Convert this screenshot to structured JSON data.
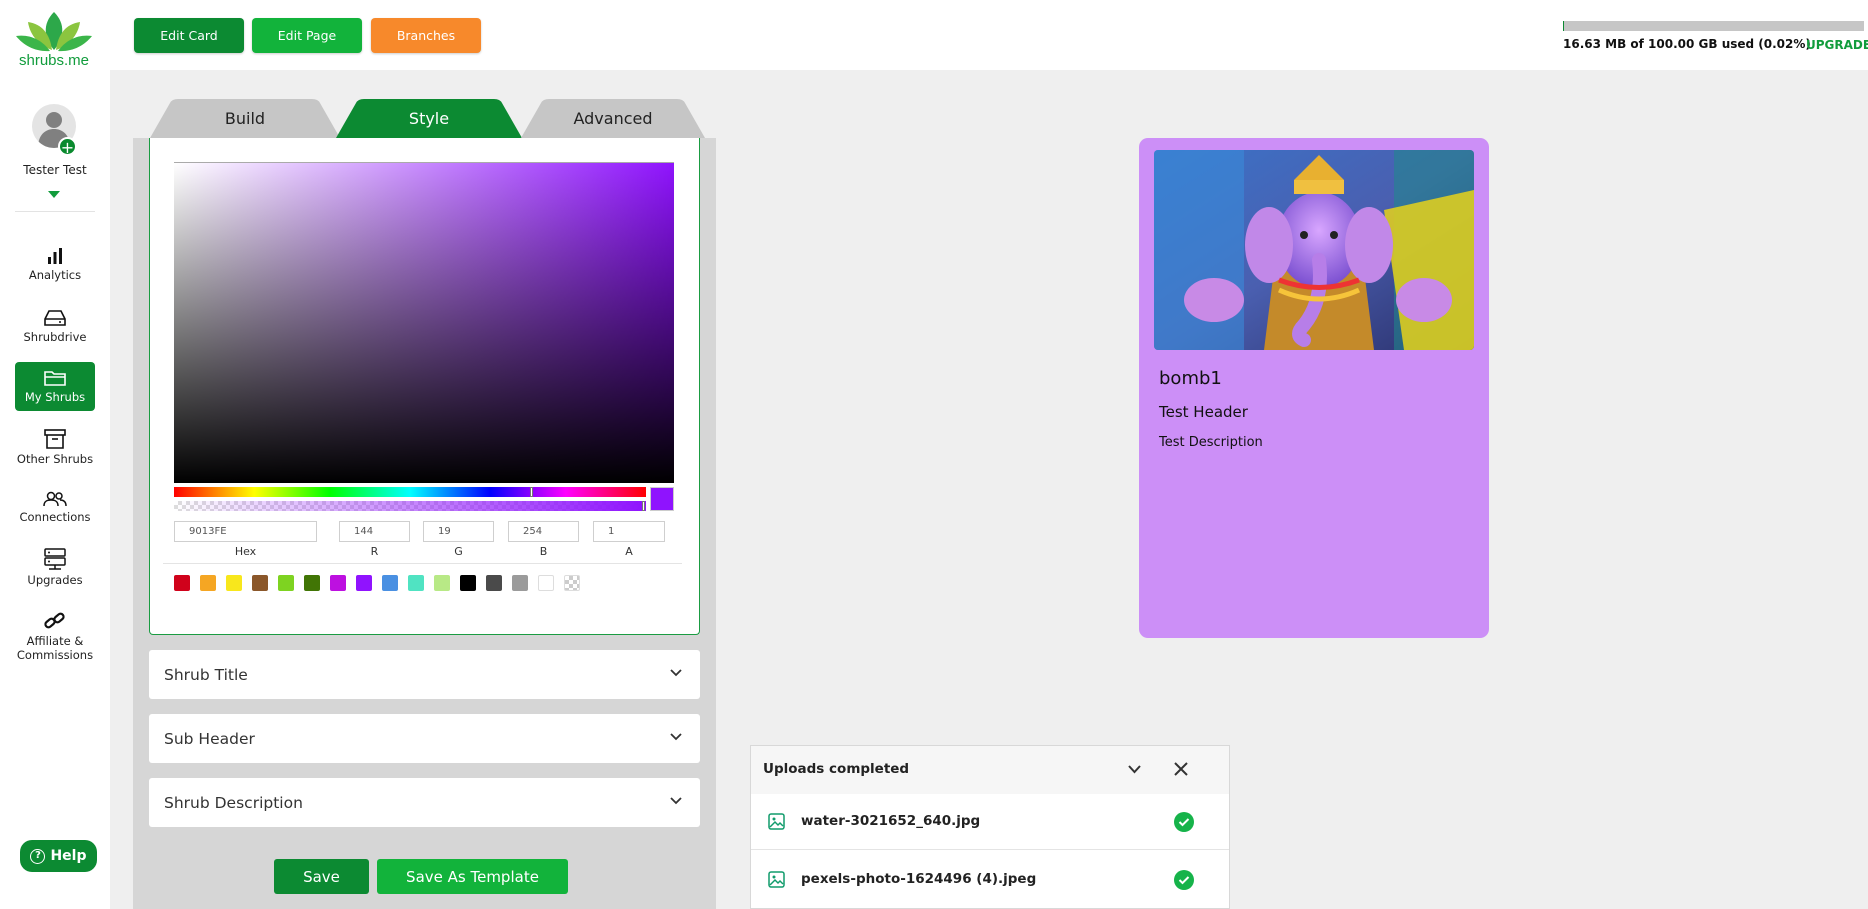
{
  "brand": {
    "name": "shrubs.me",
    "color": "#119c3c"
  },
  "user": {
    "name": "Tester Test"
  },
  "sidebar": {
    "items": [
      {
        "label": "Analytics",
        "icon": "bar-chart-icon"
      },
      {
        "label": "Shrubdrive",
        "icon": "hard-drive-icon"
      },
      {
        "label": "My Shrubs",
        "icon": "folder-icon",
        "active": true
      },
      {
        "label": "Other Shrubs",
        "icon": "archive-icon"
      },
      {
        "label": "Connections",
        "icon": "users-icon"
      },
      {
        "label": "Upgrades",
        "icon": "server-icon"
      },
      {
        "label": "Affiliate &",
        "label2": "Commissions",
        "icon": "link-icon"
      }
    ],
    "help_label": "Help"
  },
  "topbar": {
    "buttons": [
      {
        "label": "Edit Card",
        "color": "#0c8a32"
      },
      {
        "label": "Edit Page",
        "color": "#12b33b"
      },
      {
        "label": "Branches",
        "color": "#f7892b"
      }
    ],
    "storage": {
      "text": "16.63 MB of 100.00 GB used (0.02%)",
      "percent": 0.02
    },
    "upgrade_label": "UPGRADE"
  },
  "tabs": [
    {
      "label": "Build",
      "active": false
    },
    {
      "label": "Style",
      "active": true
    },
    {
      "label": "Advanced",
      "active": false
    }
  ],
  "color_picker": {
    "current_color": "#8f13fe",
    "hex": "9013FE",
    "r": "144",
    "g": "19",
    "b": "254",
    "a": "1",
    "labels": {
      "hex": "Hex",
      "r": "R",
      "g": "G",
      "b": "B",
      "a": "A"
    },
    "presets": [
      "#d0021b",
      "#f5a623",
      "#f8e71c",
      "#8b572a",
      "#7ed321",
      "#417505",
      "#bd10e0",
      "#9013fe",
      "#4a90e2",
      "#50e3c2",
      "#b8e986",
      "#000000",
      "#4a4a4a",
      "#9b9b9b",
      "#ffffff",
      "transparent"
    ]
  },
  "accordions": [
    {
      "label": "Shrub Title"
    },
    {
      "label": "Sub Header"
    },
    {
      "label": "Shrub Description"
    }
  ],
  "actions": {
    "save": "Save",
    "save_template": "Save As Template"
  },
  "card": {
    "background": "#cc8ff7",
    "title": "bomb1",
    "header": "Test Header",
    "description": "Test Description"
  },
  "uploads": {
    "title": "Uploads completed",
    "files": [
      {
        "name": "water-3021652_640.jpg",
        "status": "completed"
      },
      {
        "name": "pexels-photo-1624496 (4).jpeg",
        "status": "completed"
      }
    ]
  }
}
